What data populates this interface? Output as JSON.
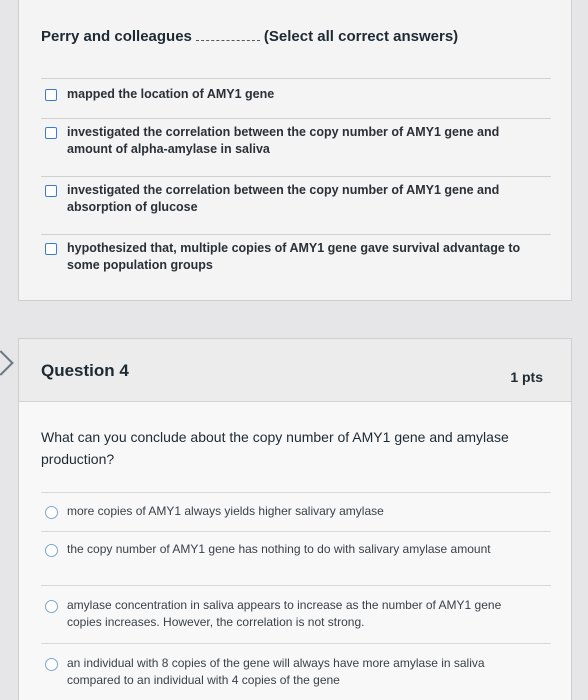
{
  "question3": {
    "prompt": "Perry and colleagues",
    "hint": "(Select all correct answers)",
    "options": [
      "mapped the location of AMY1 gene",
      "investigated the correlation between the copy number of AMY1 gene and amount of alpha-amylase in saliva",
      "investigated the correlation between the copy number of AMY1 gene and absorption of glucose",
      "hypothesized that, multiple copies of AMY1 gene gave survival advantage to some population groups"
    ]
  },
  "question4": {
    "title": "Question 4",
    "points": "1 pts",
    "text": "What can you conclude about the copy number of AMY1 gene and amylase production?",
    "options": [
      "more copies of AMY1 always yields higher salivary amylase",
      "the copy number of AMY1 gene has nothing to do with salivary amylase amount",
      "amylase concentration in saliva appears to increase as the number of AMY1 gene copies increases. However, the correlation is not strong.",
      "an individual with 8 copies of the gene will always have more amylase in saliva compared to an individual with 4 copies of the gene"
    ]
  }
}
